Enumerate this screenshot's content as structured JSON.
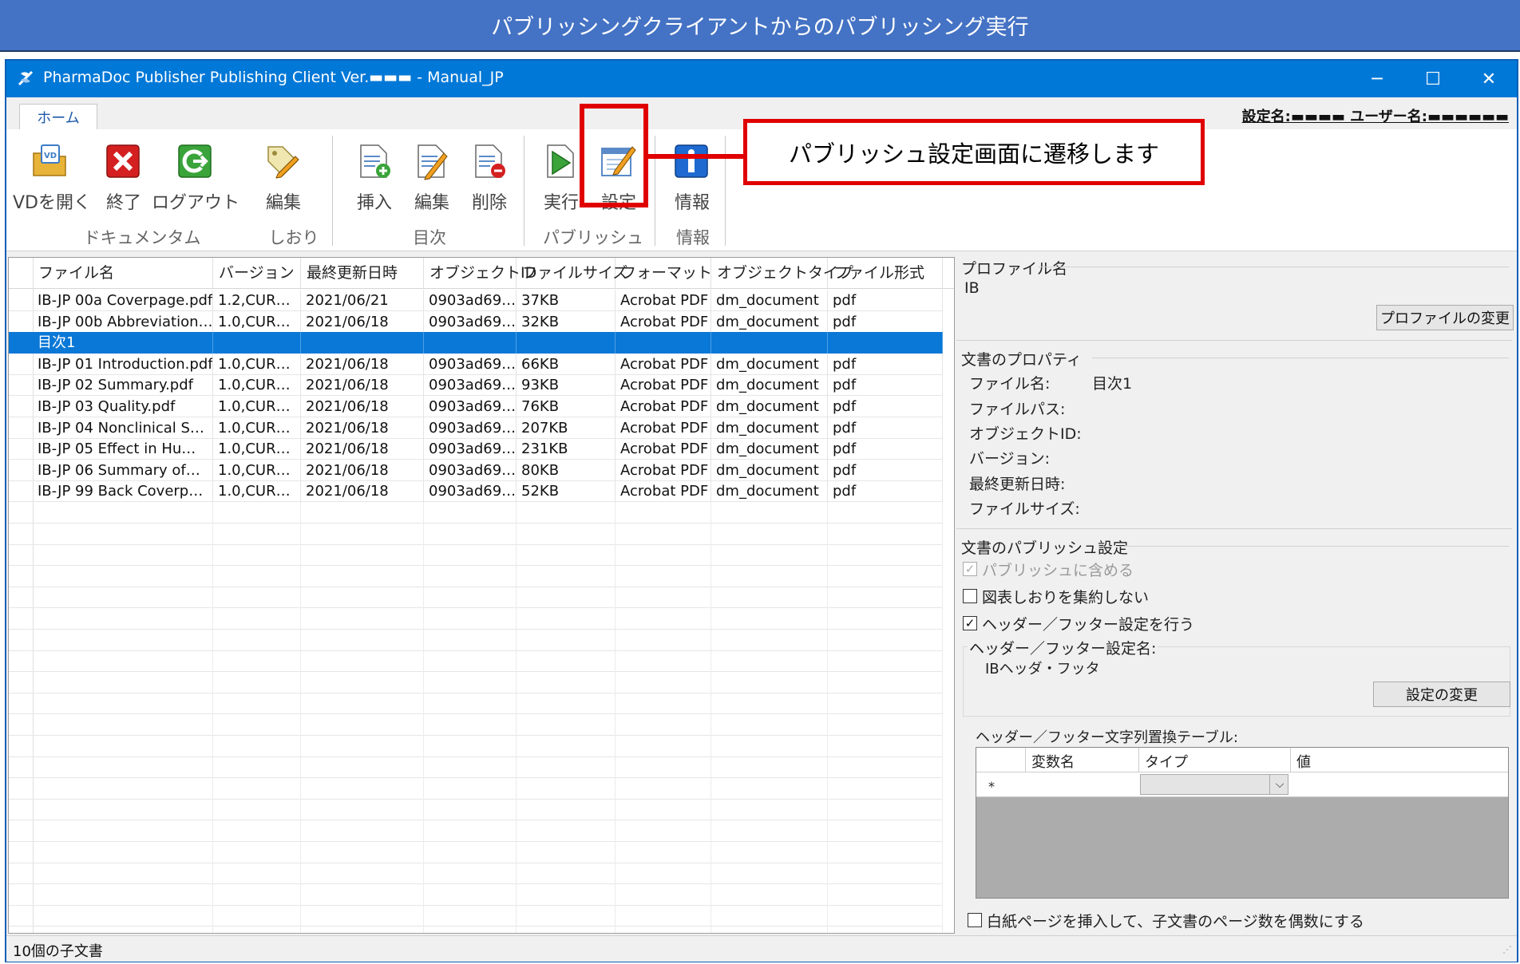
{
  "banner": "パブリッシングクライアントからのパブリッシング実行",
  "window": {
    "title": "PharmaDoc Publisher Publishing Client Ver.▬▬▬ - Manual_JP",
    "minimize": "─",
    "maximize": "☐",
    "close": "✕"
  },
  "tabs": {
    "home": "ホーム"
  },
  "user_info": "設定名:▬▬▬▬  ユーザー名:▬▬▬▬▬▬",
  "ribbon": {
    "buttons": {
      "open_vd": "VDを開く",
      "exit": "終了",
      "logout": "ログアウト",
      "bookmark_edit": "編集",
      "toc_insert": "挿入",
      "toc_edit": "編集",
      "toc_delete": "削除",
      "run": "実行",
      "settings": "設定",
      "info": "情報"
    },
    "groups": {
      "document": "ドキュメンタム",
      "bookmark": "しおり",
      "toc": "目次",
      "publish": "パブリッシュ",
      "info": "情報"
    }
  },
  "callout": "パブリッシュ設定画面に遷移します",
  "grid": {
    "headers": [
      "ファイル名",
      "バージョン",
      "最終更新日時",
      "オブジェクトID",
      "ファイルサイズ",
      "フォーマット",
      "オブジェクトタイプ",
      "ファイル形式"
    ],
    "rows": [
      [
        "IB-JP 00a Coverpage.pdf",
        "1.2,CUR…",
        "2021/06/21",
        "0903ad69…",
        "37KB",
        "Acrobat PDF",
        "dm_document",
        "pdf"
      ],
      [
        "IB-JP 00b Abbreviation…",
        "1.0,CUR…",
        "2021/06/18",
        "0903ad69…",
        "32KB",
        "Acrobat PDF",
        "dm_document",
        "pdf"
      ],
      [
        "目次1",
        "",
        "",
        "",
        "",
        "",
        "",
        ""
      ],
      [
        "IB-JP 01 Introduction.pdf",
        "1.0,CUR…",
        "2021/06/18",
        "0903ad69…",
        "66KB",
        "Acrobat PDF",
        "dm_document",
        "pdf"
      ],
      [
        "IB-JP 02 Summary.pdf",
        "1.0,CUR…",
        "2021/06/18",
        "0903ad69…",
        "93KB",
        "Acrobat PDF",
        "dm_document",
        "pdf"
      ],
      [
        "IB-JP 03 Quality.pdf",
        "1.0,CUR…",
        "2021/06/18",
        "0903ad69…",
        "76KB",
        "Acrobat PDF",
        "dm_document",
        "pdf"
      ],
      [
        "IB-JP 04 Nonclinical S…",
        "1.0,CUR…",
        "2021/06/18",
        "0903ad69…",
        "207KB",
        "Acrobat PDF",
        "dm_document",
        "pdf"
      ],
      [
        "IB-JP 05 Effect in Hu…",
        "1.0,CUR…",
        "2021/06/18",
        "0903ad69…",
        "231KB",
        "Acrobat PDF",
        "dm_document",
        "pdf"
      ],
      [
        "IB-JP 06 Summary of…",
        "1.0,CUR…",
        "2021/06/18",
        "0903ad69…",
        "80KB",
        "Acrobat PDF",
        "dm_document",
        "pdf"
      ],
      [
        "IB-JP 99 Back Coverp…",
        "1.0,CUR…",
        "2021/06/18",
        "0903ad69…",
        "52KB",
        "Acrobat PDF",
        "dm_document",
        "pdf"
      ]
    ]
  },
  "profile": {
    "section": "プロファイル名",
    "value": "IB",
    "change_button": "プロファイルの変更"
  },
  "doc_props": {
    "section": "文書のプロパティ",
    "file_name_label": "ファイル名:",
    "file_name_value": "目次1",
    "file_path_label": "ファイルパス:",
    "object_id_label": "オブジェクトID:",
    "version_label": "バージョン:",
    "modified_label": "最終更新日時:",
    "size_label": "ファイルサイズ:"
  },
  "publish_settings": {
    "section": "文書のパブリッシュ設定",
    "include": "パブリッシュに含める",
    "no_aggregate": "図表しおりを集約しない",
    "header_footer": "ヘッダー／フッター設定を行う",
    "hf_name_label": "ヘッダー／フッター設定名:",
    "hf_name_value": "IBヘッダ・フッタ",
    "change_button": "設定の変更",
    "table_label": "ヘッダー／フッター文字列置換テーブル:",
    "table_headers": [
      "変数名",
      "タイプ",
      "値"
    ],
    "new_row_marker": "*",
    "blank_page": "白紙ページを挿入して、子文書のページ数を偶数にする"
  },
  "status": "10個の子文書"
}
